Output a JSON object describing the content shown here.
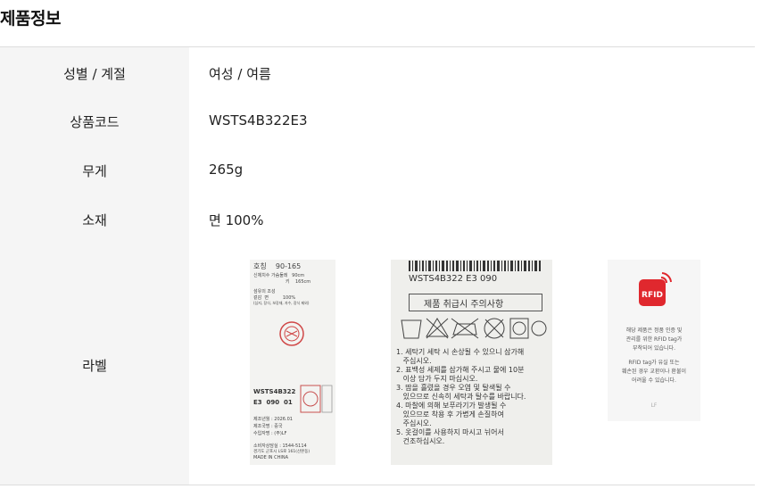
{
  "section_title": "제품정보",
  "rows": [
    {
      "label": "성별 / 계절",
      "value": "여성 / 여름"
    },
    {
      "label": "상품코드",
      "value": "WSTS4B322E3"
    },
    {
      "label": "무게",
      "value": "265g"
    },
    {
      "label": "소재",
      "value": "면 100%"
    },
    {
      "label": "라벨"
    }
  ],
  "label_images": {
    "size_tag": {
      "size_line": "호칭    90-165",
      "body_line": "신체치수 가슴둘레   90cm",
      "height_line": "키    165cm",
      "fiber_title": "섬유의 조성",
      "fiber_line": "겉감  면          100%",
      "fiber_note": "(심지, 장식, 보강재, 자수, 장식 제외)",
      "code1": "WSTS4B322",
      "code2": "E3  090  01",
      "date": "제조년월 : 2026.01",
      "origin": "제조국명 : 중국",
      "importer": "수입자명 : (주)LF",
      "phone": "소비자상담실 : 1544-5114",
      "address": "경기도 군포시 LS로 161(산본동)",
      "made_in": "MADE IN CHINA"
    },
    "care_tag": {
      "code": "WSTS4B322 E3 090",
      "title": "제품 취급시 주의사항",
      "symbols": [
        "손세탁 30℃",
        "표백X",
        "다림질",
        "드라이",
        "건조"
      ],
      "instructions": [
        "1. 세탁기 세탁 시 손상될 수 있으니 삼가해",
        "   주십시오.",
        "2. 표백성 세제를 삼가해 주시고 물에 10분",
        "   이상 담가 두지 마십시오.",
        "3. 땀을 흘렸을 경우 오염 및 탈색될 수",
        "   있으므로 신속히 세탁과 탈수를 바랍니다.",
        "4. 마찰에 의해 보푸라기가 발생될 수",
        "   있으므로 착용 후 가볍게 손질하여",
        "   주십시오.",
        "5. 옷걸이를 사용하지 마시고 뉘어서",
        "   건조하십시오."
      ]
    },
    "rfid_tag": {
      "badge": "RFID",
      "text1": "해당 제품은 정품 인증 및",
      "text2": "관리를 위한 RFID tag가",
      "text3": "부착되어 있습니다.",
      "text4": "RFID tag가 유실 또는",
      "text5": "훼손된 경우 교환이나 환불이",
      "text6": "어려울 수 있습니다.",
      "logo": "LF",
      "accent": "#e0282e"
    }
  }
}
